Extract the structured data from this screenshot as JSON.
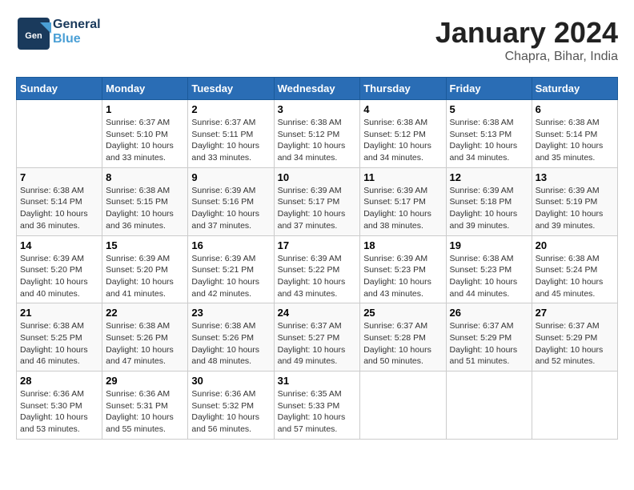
{
  "logo": {
    "line1": "General",
    "line2": "Blue"
  },
  "title": "January 2024",
  "subtitle": "Chapra, Bihar, India",
  "header": {
    "days": [
      "Sunday",
      "Monday",
      "Tuesday",
      "Wednesday",
      "Thursday",
      "Friday",
      "Saturday"
    ]
  },
  "weeks": [
    [
      {
        "day": "",
        "sunrise": "",
        "sunset": "",
        "daylight": ""
      },
      {
        "day": "1",
        "sunrise": "Sunrise: 6:37 AM",
        "sunset": "Sunset: 5:10 PM",
        "daylight": "Daylight: 10 hours and 33 minutes."
      },
      {
        "day": "2",
        "sunrise": "Sunrise: 6:37 AM",
        "sunset": "Sunset: 5:11 PM",
        "daylight": "Daylight: 10 hours and 33 minutes."
      },
      {
        "day": "3",
        "sunrise": "Sunrise: 6:38 AM",
        "sunset": "Sunset: 5:12 PM",
        "daylight": "Daylight: 10 hours and 34 minutes."
      },
      {
        "day": "4",
        "sunrise": "Sunrise: 6:38 AM",
        "sunset": "Sunset: 5:12 PM",
        "daylight": "Daylight: 10 hours and 34 minutes."
      },
      {
        "day": "5",
        "sunrise": "Sunrise: 6:38 AM",
        "sunset": "Sunset: 5:13 PM",
        "daylight": "Daylight: 10 hours and 34 minutes."
      },
      {
        "day": "6",
        "sunrise": "Sunrise: 6:38 AM",
        "sunset": "Sunset: 5:14 PM",
        "daylight": "Daylight: 10 hours and 35 minutes."
      }
    ],
    [
      {
        "day": "7",
        "sunrise": "Sunrise: 6:38 AM",
        "sunset": "Sunset: 5:14 PM",
        "daylight": "Daylight: 10 hours and 36 minutes."
      },
      {
        "day": "8",
        "sunrise": "Sunrise: 6:38 AM",
        "sunset": "Sunset: 5:15 PM",
        "daylight": "Daylight: 10 hours and 36 minutes."
      },
      {
        "day": "9",
        "sunrise": "Sunrise: 6:39 AM",
        "sunset": "Sunset: 5:16 PM",
        "daylight": "Daylight: 10 hours and 37 minutes."
      },
      {
        "day": "10",
        "sunrise": "Sunrise: 6:39 AM",
        "sunset": "Sunset: 5:17 PM",
        "daylight": "Daylight: 10 hours and 37 minutes."
      },
      {
        "day": "11",
        "sunrise": "Sunrise: 6:39 AM",
        "sunset": "Sunset: 5:17 PM",
        "daylight": "Daylight: 10 hours and 38 minutes."
      },
      {
        "day": "12",
        "sunrise": "Sunrise: 6:39 AM",
        "sunset": "Sunset: 5:18 PM",
        "daylight": "Daylight: 10 hours and 39 minutes."
      },
      {
        "day": "13",
        "sunrise": "Sunrise: 6:39 AM",
        "sunset": "Sunset: 5:19 PM",
        "daylight": "Daylight: 10 hours and 39 minutes."
      }
    ],
    [
      {
        "day": "14",
        "sunrise": "Sunrise: 6:39 AM",
        "sunset": "Sunset: 5:20 PM",
        "daylight": "Daylight: 10 hours and 40 minutes."
      },
      {
        "day": "15",
        "sunrise": "Sunrise: 6:39 AM",
        "sunset": "Sunset: 5:20 PM",
        "daylight": "Daylight: 10 hours and 41 minutes."
      },
      {
        "day": "16",
        "sunrise": "Sunrise: 6:39 AM",
        "sunset": "Sunset: 5:21 PM",
        "daylight": "Daylight: 10 hours and 42 minutes."
      },
      {
        "day": "17",
        "sunrise": "Sunrise: 6:39 AM",
        "sunset": "Sunset: 5:22 PM",
        "daylight": "Daylight: 10 hours and 43 minutes."
      },
      {
        "day": "18",
        "sunrise": "Sunrise: 6:39 AM",
        "sunset": "Sunset: 5:23 PM",
        "daylight": "Daylight: 10 hours and 43 minutes."
      },
      {
        "day": "19",
        "sunrise": "Sunrise: 6:38 AM",
        "sunset": "Sunset: 5:23 PM",
        "daylight": "Daylight: 10 hours and 44 minutes."
      },
      {
        "day": "20",
        "sunrise": "Sunrise: 6:38 AM",
        "sunset": "Sunset: 5:24 PM",
        "daylight": "Daylight: 10 hours and 45 minutes."
      }
    ],
    [
      {
        "day": "21",
        "sunrise": "Sunrise: 6:38 AM",
        "sunset": "Sunset: 5:25 PM",
        "daylight": "Daylight: 10 hours and 46 minutes."
      },
      {
        "day": "22",
        "sunrise": "Sunrise: 6:38 AM",
        "sunset": "Sunset: 5:26 PM",
        "daylight": "Daylight: 10 hours and 47 minutes."
      },
      {
        "day": "23",
        "sunrise": "Sunrise: 6:38 AM",
        "sunset": "Sunset: 5:26 PM",
        "daylight": "Daylight: 10 hours and 48 minutes."
      },
      {
        "day": "24",
        "sunrise": "Sunrise: 6:37 AM",
        "sunset": "Sunset: 5:27 PM",
        "daylight": "Daylight: 10 hours and 49 minutes."
      },
      {
        "day": "25",
        "sunrise": "Sunrise: 6:37 AM",
        "sunset": "Sunset: 5:28 PM",
        "daylight": "Daylight: 10 hours and 50 minutes."
      },
      {
        "day": "26",
        "sunrise": "Sunrise: 6:37 AM",
        "sunset": "Sunset: 5:29 PM",
        "daylight": "Daylight: 10 hours and 51 minutes."
      },
      {
        "day": "27",
        "sunrise": "Sunrise: 6:37 AM",
        "sunset": "Sunset: 5:29 PM",
        "daylight": "Daylight: 10 hours and 52 minutes."
      }
    ],
    [
      {
        "day": "28",
        "sunrise": "Sunrise: 6:36 AM",
        "sunset": "Sunset: 5:30 PM",
        "daylight": "Daylight: 10 hours and 53 minutes."
      },
      {
        "day": "29",
        "sunrise": "Sunrise: 6:36 AM",
        "sunset": "Sunset: 5:31 PM",
        "daylight": "Daylight: 10 hours and 55 minutes."
      },
      {
        "day": "30",
        "sunrise": "Sunrise: 6:36 AM",
        "sunset": "Sunset: 5:32 PM",
        "daylight": "Daylight: 10 hours and 56 minutes."
      },
      {
        "day": "31",
        "sunrise": "Sunrise: 6:35 AM",
        "sunset": "Sunset: 5:33 PM",
        "daylight": "Daylight: 10 hours and 57 minutes."
      },
      {
        "day": "",
        "sunrise": "",
        "sunset": "",
        "daylight": ""
      },
      {
        "day": "",
        "sunrise": "",
        "sunset": "",
        "daylight": ""
      },
      {
        "day": "",
        "sunrise": "",
        "sunset": "",
        "daylight": ""
      }
    ]
  ]
}
